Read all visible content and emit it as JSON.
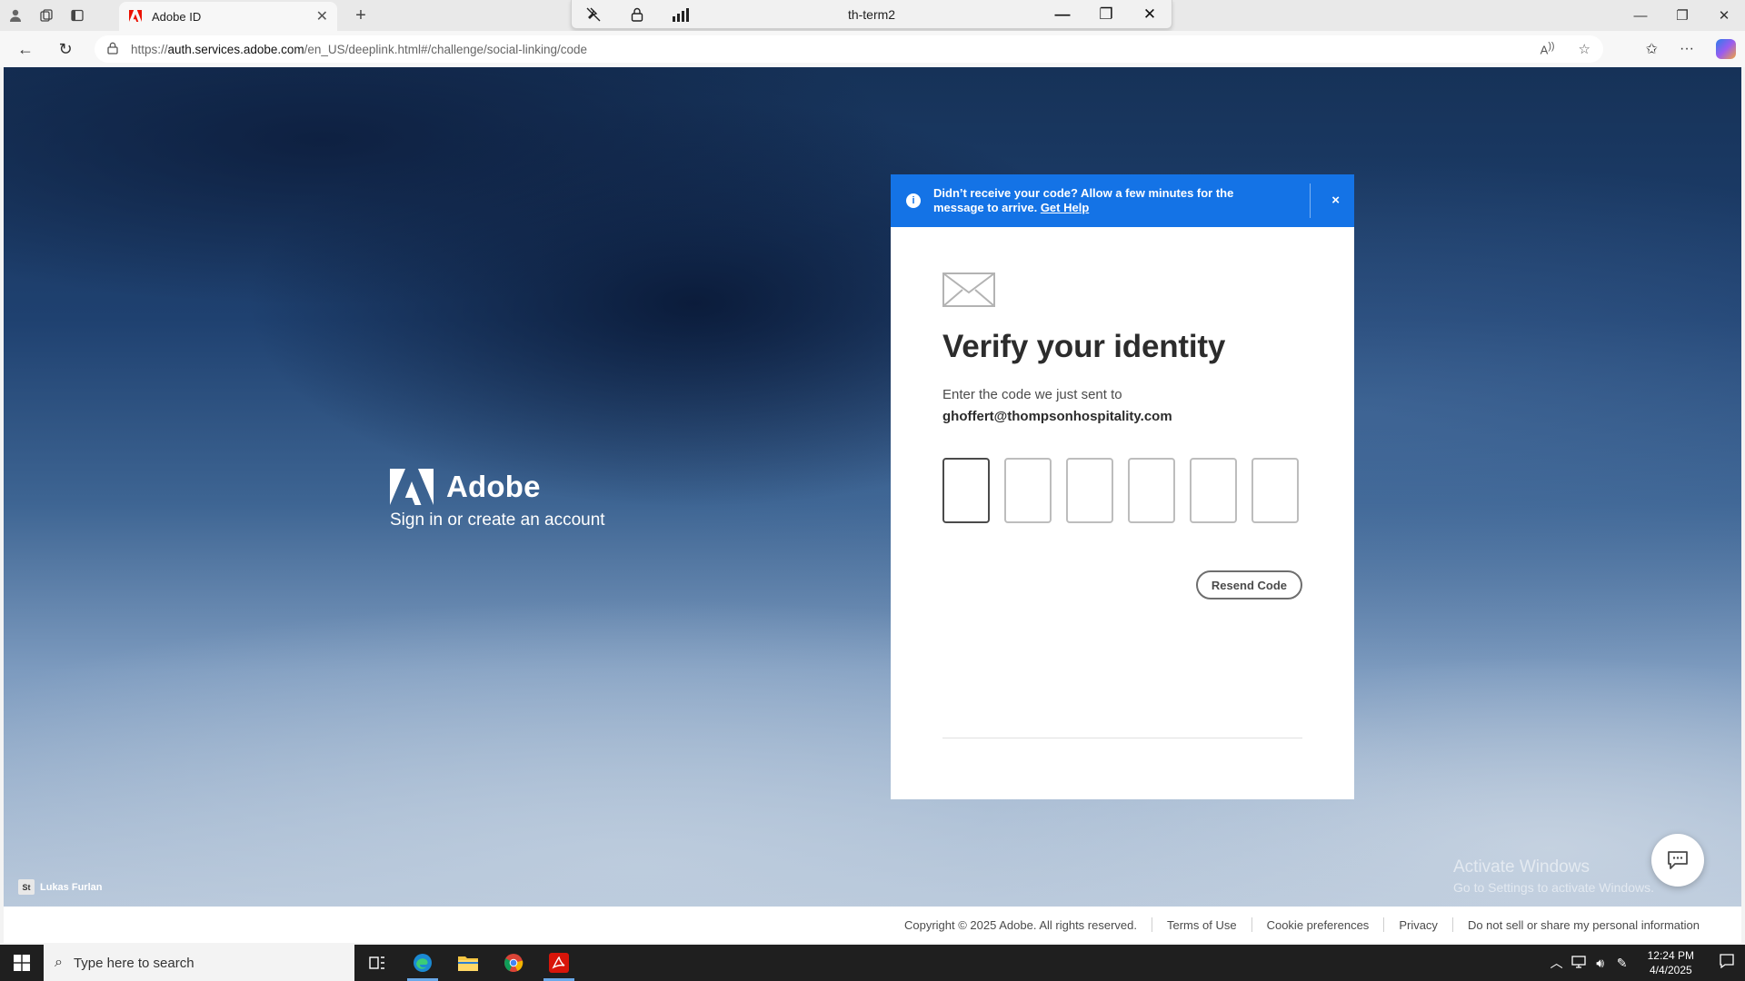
{
  "browser": {
    "tab_title": "Adobe ID",
    "url_host": "auth.services.adobe.com",
    "url_prefix": "https://",
    "url_path": "/en_US/deeplink.html#/challenge/social-linking/code",
    "remote_title": "th-term2"
  },
  "notice": {
    "message": "Didn’t receive your code? Allow a few minutes for the message to arrive.",
    "help_link": "Get Help",
    "close": "×"
  },
  "brand": {
    "name": "Adobe",
    "tagline": "Sign in or create an account"
  },
  "verify": {
    "title": "Verify your identity",
    "subtitle": "Enter the code we just sent to",
    "email": "ghoffert@thompsonhospitality.com",
    "code_digits": [
      "",
      "",
      "",
      "",
      "",
      ""
    ],
    "resend_label": "Resend Code"
  },
  "photo_credit": {
    "badge": "St",
    "name": "Lukas Furlan"
  },
  "watermark": {
    "line1": "Activate Windows",
    "line2": "Go to Settings to activate Windows."
  },
  "footer": {
    "copyright": "Copyright © 2025 Adobe. All rights reserved.",
    "links": [
      "Terms of Use",
      "Cookie preferences",
      "Privacy",
      "Do not sell or share my personal information"
    ]
  },
  "taskbar": {
    "search_placeholder": "Type here to search",
    "time": "12:24 PM",
    "date": "4/4/2025"
  },
  "colors": {
    "accent_blue": "#1473e6",
    "adobe_red": "#eb1000"
  }
}
